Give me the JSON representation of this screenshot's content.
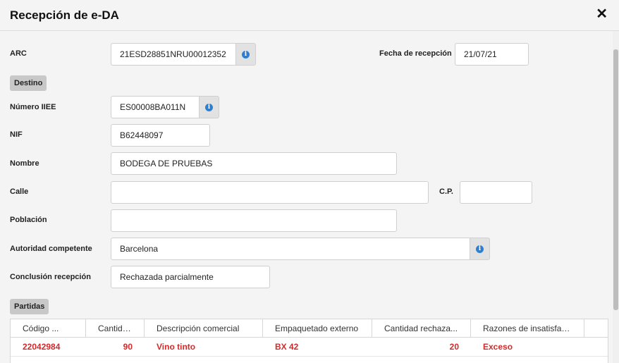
{
  "dialog": {
    "title": "Recepción de e-DA",
    "close_symbol": "✕"
  },
  "fields": {
    "arc": {
      "label": "ARC",
      "value": "21ESD28851NRU00012352"
    },
    "fecha_recepcion": {
      "label": "Fecha de recepción",
      "value": "21/07/21"
    },
    "destino_section": "Destino",
    "numero_iiee": {
      "label": "Número IIEE",
      "value": "ES00008BA011N"
    },
    "nif": {
      "label": "NIF",
      "value": "B62448097"
    },
    "nombre": {
      "label": "Nombre",
      "value": "BODEGA DE PRUEBAS"
    },
    "calle": {
      "label": "Calle",
      "value": ""
    },
    "cp": {
      "label": "C.P.",
      "value": ""
    },
    "poblacion": {
      "label": "Población",
      "value": ""
    },
    "autoridad": {
      "label": "Autoridad competente",
      "value": "Barcelona"
    },
    "conclusion": {
      "label": "Conclusión recepción",
      "value": "Rechazada parcialmente"
    },
    "partidas_section": "Partidas"
  },
  "icons": {
    "info": "info-icon",
    "close": "close-icon",
    "info_glyph": "i"
  },
  "partidas": {
    "columns": [
      "Código ...",
      "Cantidad",
      "Descripción comercial",
      "Empaquetado externo",
      "Cantidad rechaza...",
      "Razones de insatisfac..."
    ],
    "rows": [
      {
        "codigo": "22042984",
        "cantidad": "90",
        "descripcion": "Vino tinto",
        "empaquetado": "BX 42",
        "cantidad_rechazada": "20",
        "razones": "Exceso"
      }
    ]
  },
  "colors": {
    "error_text": "#d42a2a",
    "info_icon": "#2f7fd1",
    "section_badge": "#c8c8c8"
  }
}
